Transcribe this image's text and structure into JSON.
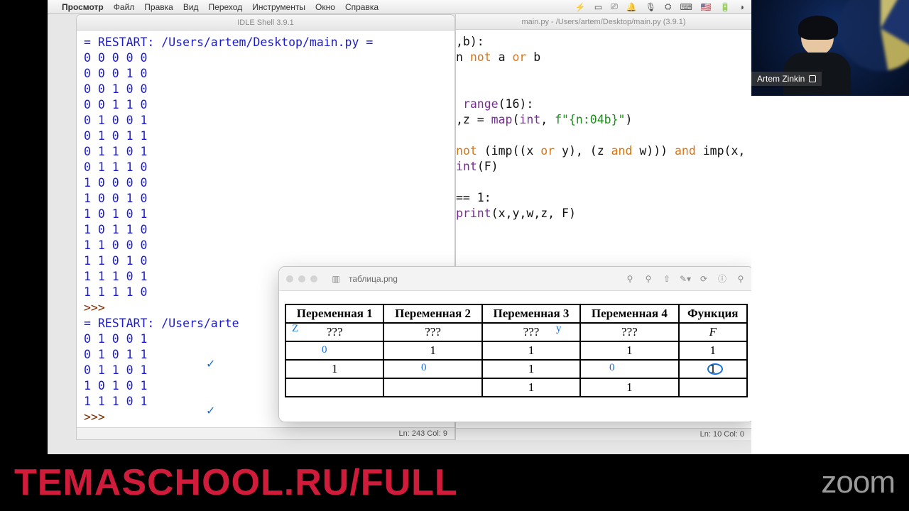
{
  "menubar": {
    "app": "Просмотр",
    "items": [
      "Файл",
      "Правка",
      "Вид",
      "Переход",
      "Инструменты",
      "Окно",
      "Справка"
    ],
    "right_icons": [
      "⚡",
      "▭",
      "⎚",
      "🔔",
      "🎙",
      "⛭",
      "⌨",
      "🇺🇸",
      "🔋",
      "◑"
    ]
  },
  "idle": {
    "title": "IDLE Shell 3.9.1",
    "restart1": "= RESTART: /Users/artem/Desktop/main.py =",
    "rows": [
      "0 0 0 0 0",
      "0 0 0 1 0",
      "0 0 1 0 0",
      "0 0 1 1 0",
      "0 1 0 0 1",
      "0 1 0 1 1",
      "0 1 1 0 1",
      "0 1 1 1 0",
      "1 0 0 0 0",
      "1 0 0 1 0",
      "1 0 1 0 1",
      "1 0 1 1 0",
      "1 1 0 0 0",
      "1 1 0 1 0",
      "1 1 1 0 1",
      "1 1 1 1 0"
    ],
    "prompt": ">>> ",
    "restart2": "= RESTART: /Users/arte",
    "rows2": [
      "0 1 0 0 1",
      "0 1 0 1 1",
      "0 1 1 0 1",
      "1 0 1 0 1",
      "1 1 1 0 1"
    ],
    "status": "Ln: 243  Col: 9"
  },
  "editor": {
    "title": "main.py - /Users/artem/Desktop/main.py (3.9.1)",
    "status": "Ln: 10  Col: 0",
    "frag": {
      "l1a": ",b):",
      "l2a": "n ",
      "l2b": "not",
      "l2c": " a ",
      "l2d": "or",
      "l2e": " b",
      "l3a": " ",
      "l3b": "range",
      "l3c": "(16):",
      "l4a": ",z = ",
      "l4b": "map",
      "l4c": "(",
      "l4d": "int",
      "l4e": ", ",
      "l4f": "f\"{n:04b}\"",
      "l4g": ")",
      "l5a": "not",
      "l5b": " (imp((x ",
      "l5c": "or",
      "l5d": " y), (z ",
      "l5e": "and",
      "l5f": " w))) ",
      "l5g": "and",
      "l5h": " imp(x, w)",
      "l6a": "int",
      "l6b": "(F)",
      "l7a": "== 1:",
      "l8a": "print",
      "l8b": "(x,y,w,z, F)"
    }
  },
  "preview": {
    "filename": "таблица.png",
    "headers": [
      "Переменная 1",
      "Переменная 2",
      "Переменная 3",
      "Переменная 4",
      "Функция"
    ],
    "row_q": [
      "???",
      "???",
      "???",
      "???",
      "F"
    ],
    "rows": [
      [
        "",
        "1",
        "1",
        "1",
        "1"
      ],
      [
        "1",
        "",
        "1",
        "",
        "1"
      ],
      [
        "",
        "",
        "1",
        "1",
        ""
      ]
    ],
    "annot": {
      "z": "Z",
      "y": "y",
      "o1": "0",
      "o2": "0",
      "o3": "0",
      "circ": "1"
    }
  },
  "cam": {
    "name": "Artem Zinkin"
  },
  "banner": {
    "url": "TEMASCHOOL.RU/FULL",
    "brand": "zoom"
  }
}
